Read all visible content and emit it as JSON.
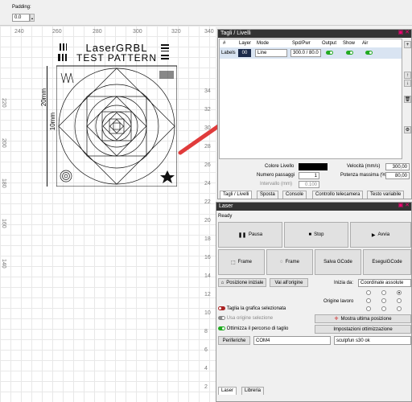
{
  "toolbar": {
    "padding_label": "Padding:",
    "padding_value": "0.0"
  },
  "ruler": {
    "top": [
      "240",
      "260",
      "280",
      "300",
      "320",
      "340"
    ],
    "left": [
      "220",
      "200",
      "180",
      "160",
      "140"
    ],
    "right": [
      "34",
      "32",
      "30",
      "28",
      "26",
      "24",
      "22",
      "20",
      "18",
      "16",
      "14",
      "12",
      "10",
      "8",
      "6",
      "4",
      "2",
      "0"
    ],
    "bottom_left": [
      "240",
      "260"
    ]
  },
  "canvas": {
    "title1": "LaserGRBL",
    "title2": "TEST PATTERN",
    "dim_20mm": "20mm",
    "dim_10mm": "10mm"
  },
  "cuts": {
    "title": "Tagli / Livelli",
    "columns": [
      "#",
      "Layer",
      "Mode",
      "Spd/Pwr",
      "Output",
      "Show",
      "Air"
    ],
    "row": {
      "label": "Labels",
      "layer": "00",
      "mode": "Line",
      "spdpwr": "300.0 / 80.0"
    },
    "colore_label": "Colore Livello",
    "passaggi_label": "Numero passaggi",
    "passaggi_value": "1",
    "intervallo_label": "Intervallo (mm)",
    "intervallo_value": "0.100",
    "velocita_label": "Velocità (mm/s)",
    "velocita_value": "300,00",
    "potenza_label": "Potenza massima (%)",
    "potenza_value": "80,00",
    "tabs": [
      "Tagli / Livelli",
      "Sposta",
      "Console",
      "Controllo telecamera",
      "Testo variabile"
    ]
  },
  "laser": {
    "title": "Laser",
    "status": "Ready",
    "pausa": "Pausa",
    "stop": "Stop",
    "avvia": "Avvia",
    "frame1": "Frame",
    "frame2": "Frame",
    "salva": "Salva GCode",
    "esegui": "EseguiGCode",
    "posizione": "Posizione iniziale",
    "vai": "Vai all'origine",
    "inizia_label": "Inizia da:",
    "inizia_value": "Coordinate assolute",
    "origine_label": "Origine lavoro",
    "taglia": "Taglia la grafica selezionata",
    "usa": "Usa origine selezione",
    "ottimizza": "Ottimizza il percorso di taglio",
    "mostra": "Mostra ultima posizione",
    "impostazioni": "Impostazioni ottimizzazione",
    "periferiche": "Periferiche",
    "com": "COM4",
    "device": "sculpfun s30 ok",
    "tabs": [
      "Laser",
      "Libreria"
    ]
  },
  "colors": {
    "title_bar": "#333333",
    "accent_pink": "#ff0080",
    "arrow": "#e03b3b",
    "layer_chip": "#1b2a4a"
  }
}
